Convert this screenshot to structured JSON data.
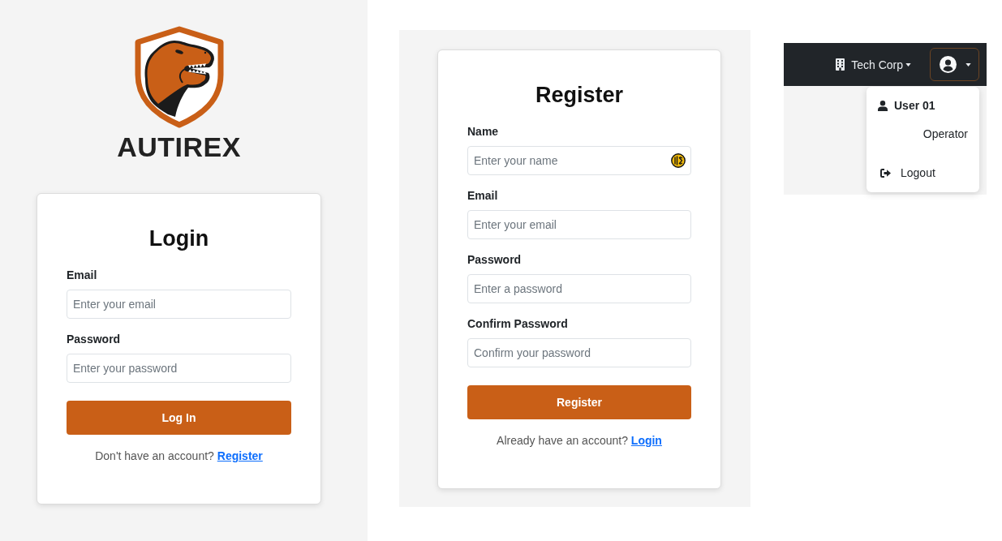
{
  "brand": {
    "name": "AUTIREX"
  },
  "login": {
    "title": "Login",
    "fields": [
      {
        "label": "Email",
        "placeholder": "Enter your email"
      },
      {
        "label": "Password",
        "placeholder": "Enter your password"
      }
    ],
    "submit": "Log In",
    "footer": {
      "text": "Don't have an account?",
      "link": "Register"
    }
  },
  "register": {
    "title": "Register",
    "fields": [
      {
        "label": "Name",
        "placeholder": "Enter your name",
        "autofill_badge": true
      },
      {
        "label": "Email",
        "placeholder": "Enter your email",
        "autofill_badge": false
      },
      {
        "label": "Password",
        "placeholder": "Enter a password",
        "autofill_badge": false
      },
      {
        "label": "Confirm Password",
        "placeholder": "Confirm your password",
        "autofill_badge": false
      }
    ],
    "submit": "Register",
    "footer": {
      "text": "Already have an account?",
      "link": "Login"
    }
  },
  "navbar": {
    "company": "Tech Corp",
    "user_menu": {
      "expanded": true,
      "user": "User 01",
      "role": "Operator",
      "logout": "Logout"
    }
  }
}
